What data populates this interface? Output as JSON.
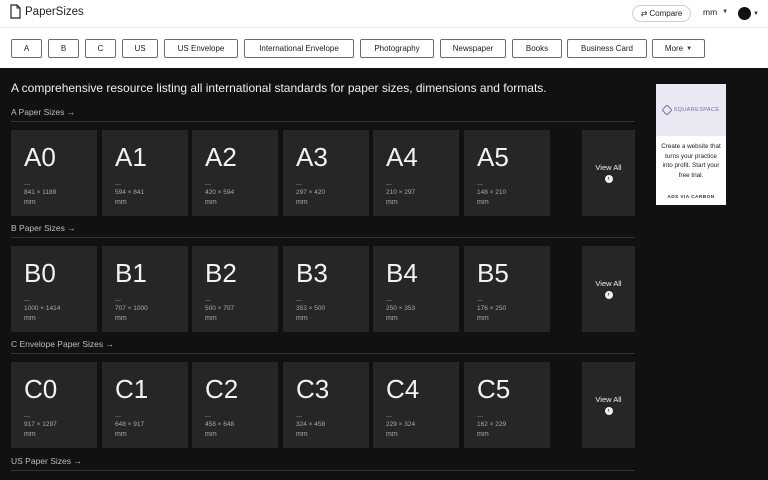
{
  "header": {
    "logo_text": "PaperSizes",
    "compare_label": "Compare",
    "unit": "mm"
  },
  "categories": [
    {
      "label": "A"
    },
    {
      "label": "B"
    },
    {
      "label": "C"
    },
    {
      "label": "US"
    },
    {
      "label": "US Envelope"
    },
    {
      "label": "International Envelope"
    },
    {
      "label": "Photography"
    },
    {
      "label": "Newspaper"
    },
    {
      "label": "Books"
    },
    {
      "label": "Business Card"
    },
    {
      "label": "More"
    }
  ],
  "intro": "A comprehensive resource listing all international standards for paper sizes, dimensions and formats.",
  "view_all_label": "View All",
  "sections": [
    {
      "title": "A Paper Sizes →",
      "cards": [
        {
          "name": "A0",
          "dims": "841 × 1189",
          "unit": "mm"
        },
        {
          "name": "A1",
          "dims": "594 × 841",
          "unit": "mm"
        },
        {
          "name": "A2",
          "dims": "420 × 594",
          "unit": "mm"
        },
        {
          "name": "A3",
          "dims": "297 × 420",
          "unit": "mm"
        },
        {
          "name": "A4",
          "dims": "210 × 297",
          "unit": "mm"
        },
        {
          "name": "A5",
          "dims": "148 × 210",
          "unit": "mm"
        }
      ]
    },
    {
      "title": "B Paper Sizes →",
      "cards": [
        {
          "name": "B0",
          "dims": "1000 × 1414",
          "unit": "mm"
        },
        {
          "name": "B1",
          "dims": "707 × 1000",
          "unit": "mm"
        },
        {
          "name": "B2",
          "dims": "500 × 707",
          "unit": "mm"
        },
        {
          "name": "B3",
          "dims": "353 × 500",
          "unit": "mm"
        },
        {
          "name": "B4",
          "dims": "250 × 353",
          "unit": "mm"
        },
        {
          "name": "B5",
          "dims": "176 × 250",
          "unit": "mm"
        }
      ]
    },
    {
      "title": "C Envelope Paper Sizes →",
      "cards": [
        {
          "name": "C0",
          "dims": "917 × 1297",
          "unit": "mm"
        },
        {
          "name": "C1",
          "dims": "648 × 917",
          "unit": "mm"
        },
        {
          "name": "C2",
          "dims": "458 × 648",
          "unit": "mm"
        },
        {
          "name": "C3",
          "dims": "324 × 458",
          "unit": "mm"
        },
        {
          "name": "C4",
          "dims": "229 × 324",
          "unit": "mm"
        },
        {
          "name": "C5",
          "dims": "162 × 229",
          "unit": "mm"
        }
      ]
    },
    {
      "title": "US Paper Sizes →",
      "cards": []
    }
  ],
  "ad": {
    "brand": "SQUARESPACE",
    "text": "Create a website that turns your practice into profit. Start your free trial.",
    "via": "ADS VIA CARBON"
  }
}
